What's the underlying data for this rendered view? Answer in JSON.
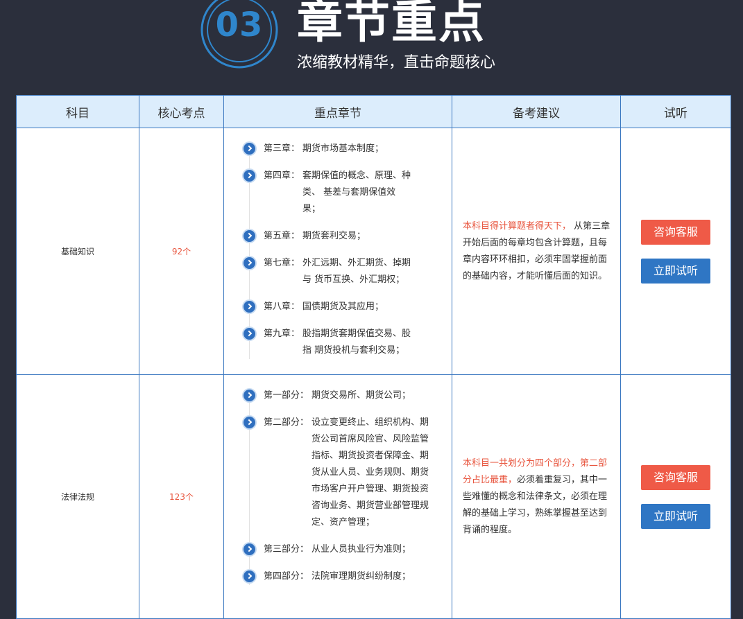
{
  "header": {
    "badge_number": "03",
    "title": "章节重点",
    "subtitle": "浓缩教材精华，直击命题核心"
  },
  "table": {
    "columns": [
      "科目",
      "核心考点",
      "重点章节",
      "备考建议",
      "试听"
    ],
    "rows": [
      {
        "subject": "基础知识",
        "count": "92个",
        "chapters": [
          {
            "label": "第三章：",
            "text": "期货市场基本制度；"
          },
          {
            "label": "第四章：",
            "text": "套期保值的概念、原理、种类、 基差与套期保值效果；"
          },
          {
            "label": "第五章：",
            "text": "期货套利交易；"
          },
          {
            "label": "第七章：",
            "text": "外汇远期、外汇期货、掉期与 货币互换、外汇期权；"
          },
          {
            "label": "第八章：",
            "text": "国债期货及其应用；"
          },
          {
            "label": "第九章：",
            "text": "股指期货套期保值交易、股指 期货投机与套利交易；"
          }
        ],
        "advice_highlight": "本科目得计算题者得天下，",
        "advice_text": " 从第三章开始后面的每章均包含计算题，且每章内容环环相扣，必须牢固掌握前面的基础内容，才能听懂后面的知识。",
        "btn_consult": "咨询客服",
        "btn_trial": "立即试听"
      },
      {
        "subject": "法律法规",
        "count": "123个",
        "chapters": [
          {
            "label": "第一部分：",
            "text": "期货交易所、期货公司；"
          },
          {
            "label": "第二部分：",
            "text": "设立变更终止、组织机构、期货公司首席风险官、风险监管指标、期货投资者保障金、期货从业人员、业务规则、期货市场客户开户管理、期货投资咨询业务、期货营业部管理规定、资产管理；"
          },
          {
            "label": "第三部分：",
            "text": "从业人员执业行为准则；"
          },
          {
            "label": "第四部分：",
            "text": "法院审理期货纠纷制度；"
          }
        ],
        "advice_highlight": "本科目一共划分为四个部分，第二部分占比最重，",
        "advice_text": "必须着重复习，其中一些难懂的概念和法律条文，必须在理解的基础上学习，熟练掌握甚至达到背诵的程度。",
        "btn_consult": "咨询客服",
        "btn_trial": "立即试听"
      }
    ]
  },
  "colors": {
    "background": "#2b2f3c",
    "header_cell": "#dcedfc",
    "border": "#3a77c0",
    "accent_red": "#ef5a47",
    "accent_blue": "#2f76c4"
  }
}
